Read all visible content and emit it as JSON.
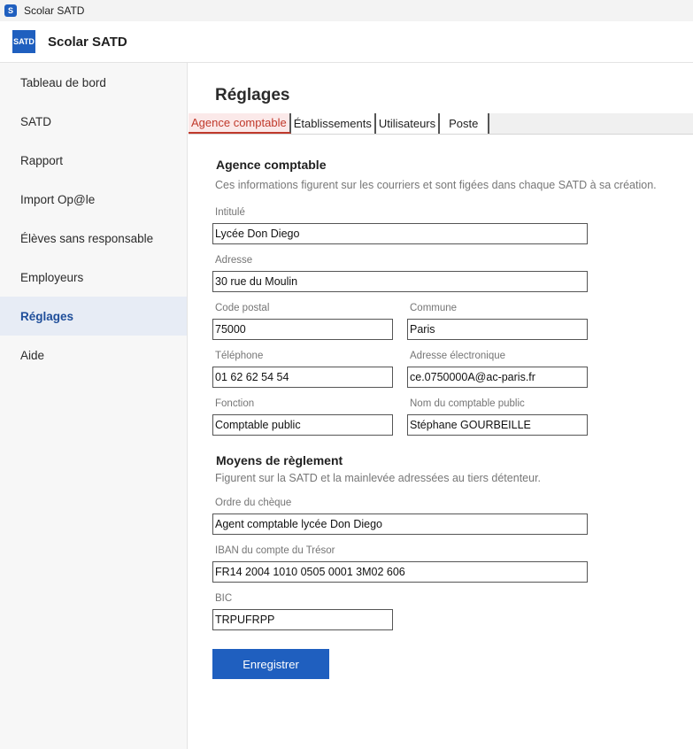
{
  "window": {
    "title": "Scolar SATD",
    "icon_letter": "S"
  },
  "header": {
    "logo_line1": "SAT",
    "logo_line2": "D",
    "app_name": "Scolar SATD"
  },
  "sidebar": {
    "items": [
      {
        "label": "Tableau de bord"
      },
      {
        "label": "SATD"
      },
      {
        "label": "Rapport"
      },
      {
        "label": "Import Op@le"
      },
      {
        "label": "Élèves sans responsable"
      },
      {
        "label": "Employeurs"
      },
      {
        "label": "Réglages",
        "active": true
      },
      {
        "label": "Aide"
      }
    ]
  },
  "page": {
    "title": "Réglages"
  },
  "tabs": [
    {
      "label": "Agence comptable",
      "active": true
    },
    {
      "label": "Établissements"
    },
    {
      "label": "Utilisateurs"
    },
    {
      "label": "Poste"
    }
  ],
  "agence": {
    "title": "Agence comptable",
    "description": "Ces informations figurent sur les courriers et sont figées dans chaque SATD à sa création.",
    "intitule": {
      "label": "Intitulé",
      "value": "Lycée Don Diego"
    },
    "adresse": {
      "label": "Adresse",
      "value": "30 rue du Moulin"
    },
    "code_postal": {
      "label": "Code postal",
      "value": "75000"
    },
    "commune": {
      "label": "Commune",
      "value": "Paris"
    },
    "telephone": {
      "label": "Téléphone",
      "value": "01 62 62 54 54"
    },
    "email": {
      "label": "Adresse électronique",
      "value": "ce.0750000A@ac-paris.fr"
    },
    "fonction": {
      "label": "Fonction",
      "value": "Comptable public"
    },
    "nom_comptable": {
      "label": "Nom du comptable public",
      "value": "Stéphane GOURBEILLE"
    }
  },
  "reglement": {
    "title": "Moyens de règlement",
    "description": "Figurent sur la SATD et la mainlevée adressées au tiers détenteur.",
    "ordre_cheque": {
      "label": "Ordre du chèque",
      "value": "Agent comptable lycée Don Diego"
    },
    "iban": {
      "label": "IBAN du compte du Trésor",
      "value": "FR14 2004 1010 0505 0001 3M02 606"
    },
    "bic": {
      "label": "BIC",
      "value": "TRPUFRPP"
    }
  },
  "actions": {
    "save_label": "Enregistrer"
  },
  "colors": {
    "accent": "#1f5fbf",
    "active_tab": "#c0392b",
    "sidebar_active_bg": "#e7ecf5"
  }
}
